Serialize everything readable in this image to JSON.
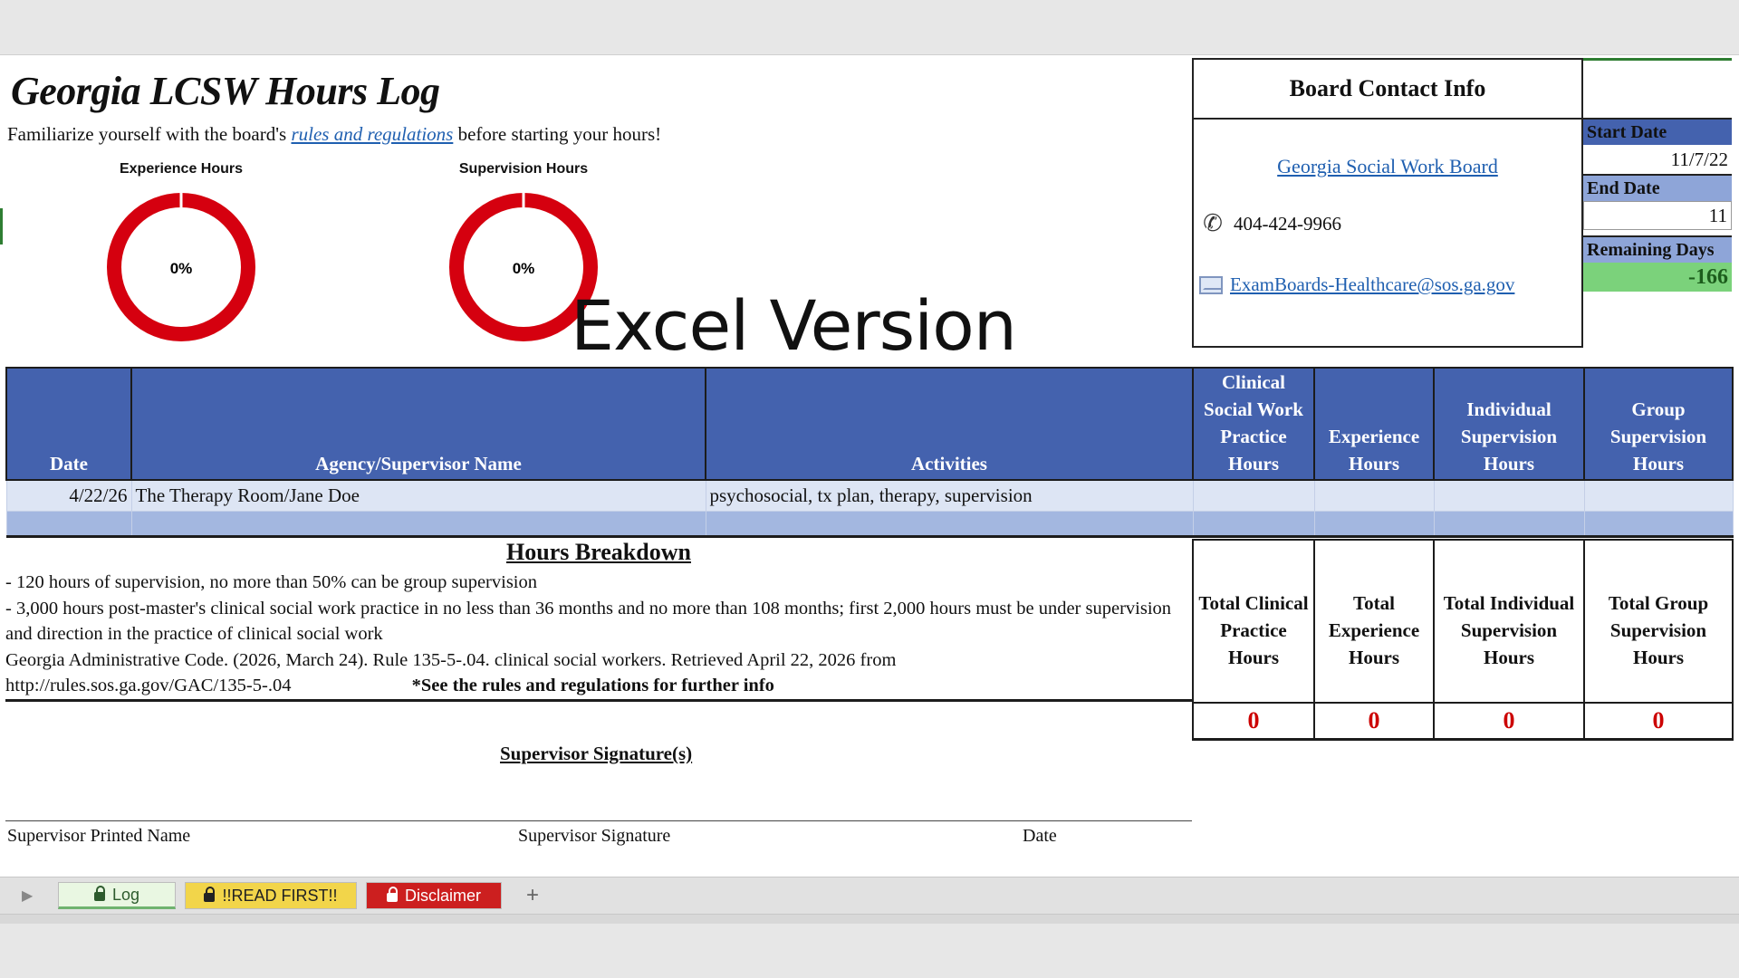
{
  "title": "Georgia LCSW Hours Log",
  "intro": {
    "before": "Familiarize yourself with the board's ",
    "link": "rules and regulations",
    "after": " before starting your hours!"
  },
  "gauges": [
    {
      "label": "Experience Hours",
      "value": "0%",
      "progress": 0
    },
    {
      "label": "Supervision Hours",
      "value": "0%",
      "progress": 0
    }
  ],
  "overlay_text": "Excel Version",
  "contact": {
    "title": "Board Contact Info",
    "board_link": "Georgia Social Work Board",
    "phone": "404-424-9966",
    "email": "ExamBoards-Healthcare@sos.ga.gov",
    "icons": [
      "phone-icon",
      "mail-icon"
    ]
  },
  "dates": {
    "start_label": "Start Date",
    "start_value": "11/7/22",
    "end_label": "End Date",
    "end_value": "11",
    "remaining_label": "Remaining Days",
    "remaining_value": "-166"
  },
  "log_table": {
    "headers": [
      "Date",
      "Agency/Supervisor Name",
      "Activities",
      "Clinical Social Work Practice Hours",
      "Experience Hours",
      "Individual Supervision Hours",
      "Group Supervision Hours"
    ],
    "rows": [
      [
        "4/22/26",
        "The Therapy Room/Jane Doe",
        "psychosocial, tx plan, therapy, supervision",
        "",
        "",
        "",
        ""
      ],
      [
        "",
        "",
        "",
        "",
        "",
        "",
        ""
      ]
    ]
  },
  "breakdown": {
    "title": "Hours Breakdown",
    "line1": "- 120 hours of supervision, no more than 50% can be group supervision",
    "line2": "- 3,000 hours post-master's clinical social work practice in no less than 36 months and no more than 108 months; first 2,000 hours must be under supervision and direction in the practice of clinical social work",
    "line3": "Georgia Administrative Code. (2026, March 24). Rule 135-5-.04. clinical social workers. Retrieved April 22, 2026 from",
    "url": "http://rules.sos.ga.gov/GAC/135-5-.04",
    "note": "*See the rules and regulations for further info"
  },
  "totals": {
    "labels": [
      "Total Clinical Practice Hours",
      "Total Experience Hours",
      "Total Individual Supervision Hours",
      "Total Group Supervision Hours"
    ],
    "values": [
      "0",
      "0",
      "0",
      "0"
    ]
  },
  "signature": {
    "title": "Supervisor Signature(s)",
    "printed_name": "Supervisor Printed Name",
    "signature": "Supervisor Signature",
    "date": "Date"
  },
  "tabs": {
    "log": "Log",
    "read_first": "!!READ FIRST!!",
    "disclaimer": "Disclaimer",
    "add": "+"
  },
  "colors": {
    "header_blue": "#4462ae",
    "gauge_red": "#d5000f",
    "remaining_green": "#7bd27b",
    "total_red": "#cc0000"
  }
}
